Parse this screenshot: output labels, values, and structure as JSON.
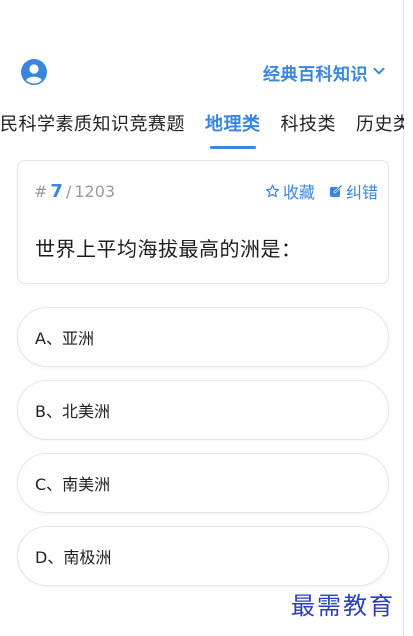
{
  "header": {
    "category_label": "经典百科知识",
    "icons": {
      "avatar": "user-avatar-icon",
      "dropdown": "chevron-down-icon"
    }
  },
  "tabs": [
    {
      "label": "民科学素质知识竞赛题",
      "active": false
    },
    {
      "label": "地理类",
      "active": true
    },
    {
      "label": "科技类",
      "active": false
    },
    {
      "label": "历史类",
      "active": false
    }
  ],
  "question": {
    "hash": "#",
    "current": "7",
    "separator": "/",
    "total": "1203",
    "text": "世界上平均海拔最高的洲是：",
    "favorite_label": "收藏",
    "report_label": "纠错"
  },
  "options": [
    {
      "label": "A、亚洲"
    },
    {
      "label": "B、北美洲"
    },
    {
      "label": "C、南美洲"
    },
    {
      "label": "D、南极洲"
    }
  ],
  "watermark": {
    "text": "最需教育"
  },
  "colors": {
    "accent": "#3a86dd",
    "watermark": "#2a3fb8"
  }
}
